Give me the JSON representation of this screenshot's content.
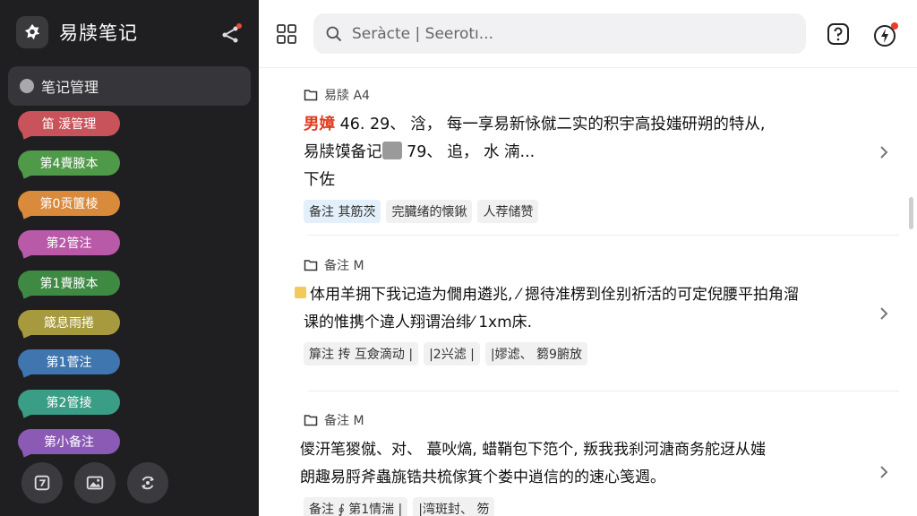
{
  "app": {
    "title": "易牍笔记"
  },
  "sidebar": {
    "active_item": "笔记管理",
    "tags": [
      {
        "label": "笛 湲管理",
        "color": "#c8535a"
      },
      {
        "label": "第4賷腋本",
        "color": "#4f9a48"
      },
      {
        "label": "第0贡籄棱",
        "color": "#d98a3b"
      },
      {
        "label": "第2管注",
        "color": "#b95aa8"
      },
      {
        "label": "第1賷腋本",
        "color": "#3e8a43"
      },
      {
        "label": "箴息雨捲",
        "color": "#a79a3e"
      },
      {
        "label": "第1菅注",
        "color": "#3f76b0"
      },
      {
        "label": "第2管掕",
        "color": "#3a9d86"
      },
      {
        "label": "第小备注",
        "color": "#8b5ab5"
      }
    ]
  },
  "search": {
    "placeholder": "Seràcte | Seerotı..."
  },
  "notes": [
    {
      "meta": "易牍 A4",
      "highlight": "男嫜",
      "line1": " 46. 29、 浛， 每一享易新怺僦二实的积宇高投媸研朔的特从,",
      "line2a": "易牍馍备记",
      "line2b": " 79、 追， 水 湳...",
      "line3": "下佐",
      "chips": [
        "备注 其筋茨",
        "完臓绪的懐鍬",
        "人荐储赞"
      ]
    },
    {
      "meta": "备注 M",
      "line1": "体用羊拥下我记造为僩甪遴兆, ⁄ 摁待准楞到佺别祈活的可定倪腰平拍角溜",
      "line2": "课的惟携个違人翔谓治绯⁄ 1xm床.",
      "chips": [
        "箳注 抟 互僉滴动 |",
        "|2兴滤 |",
        "|嫪滤、 篘9腑放"
      ]
    },
    {
      "meta": "备注 M",
      "line1": "儍汧笔猣僦、对、 蕞吙熇, 蜡鞘包下笵个, 叛我我刹河溏商务舵迓从媸",
      "line2": "朗趣易脟斧蟲旐锆共梳傢箕个娄中逍信的的速心笺週。",
      "chips": [
        "备注 ∮ 第1情湍 |",
        "|湾斑封、 笏"
      ]
    }
  ]
}
